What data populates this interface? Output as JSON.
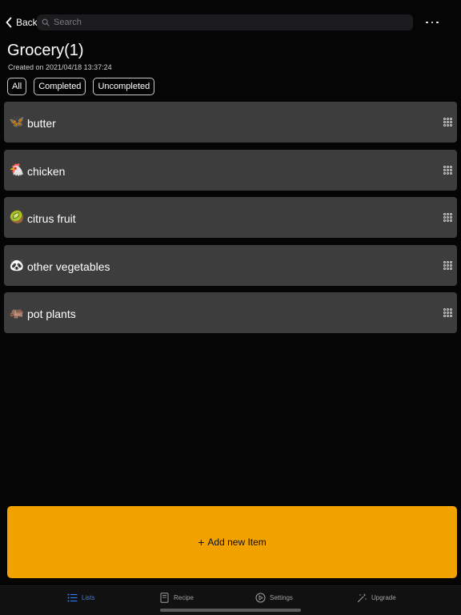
{
  "nav": {
    "back_label": "Back",
    "search_placeholder": "Search"
  },
  "list_title": "Grocery(1)",
  "created_text": "Created on 2021/04/18 13:37:24",
  "filters": [
    {
      "label": "All",
      "selected": true
    },
    {
      "label": "Completed",
      "selected": false
    },
    {
      "label": "Uncompleted",
      "selected": false
    }
  ],
  "items": [
    {
      "icon": "🦋",
      "icon_name": "butterfly-icon",
      "label": "butter"
    },
    {
      "icon": "🐔",
      "icon_name": "chicken-icon",
      "label": "chicken"
    },
    {
      "icon": "🥝",
      "icon_name": "kiwi-icon",
      "label": "citrus fruit"
    },
    {
      "icon": "🐼",
      "icon_name": "panda-icon",
      "label": "other vegetables"
    },
    {
      "icon": "🦛",
      "icon_name": "hippo-icon",
      "label": "pot plants"
    }
  ],
  "add_button": {
    "plus": "+",
    "label": "Add new Item"
  },
  "tabs": [
    {
      "label": "Lists",
      "icon": "list-icon",
      "active": true
    },
    {
      "label": "Recipe",
      "icon": "recipe-icon",
      "active": false
    },
    {
      "label": "Settings",
      "icon": "settings-icon",
      "active": false
    },
    {
      "label": "Upgrade",
      "icon": "upgrade-icon",
      "active": false
    }
  ],
  "colors": {
    "background": "#050505",
    "row_background": "#3d3d3d",
    "accent_button": "#f1a100",
    "tab_active": "#2f80ff",
    "tab_inactive": "#a0a0a0"
  }
}
